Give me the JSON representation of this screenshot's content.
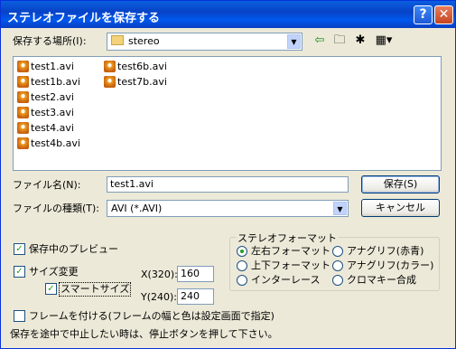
{
  "window": {
    "title": "ステレオファイルを保存する"
  },
  "location": {
    "label": "保存する場所(I):",
    "value": "stereo"
  },
  "files": [
    "test1.avi",
    "test1b.avi",
    "test2.avi",
    "test3.avi",
    "test4.avi",
    "test4b.avi",
    "test6b.avi",
    "test7b.avi"
  ],
  "filename": {
    "label": "ファイル名(N):",
    "value": "test1.avi"
  },
  "filetype": {
    "label": "ファイルの種類(T):",
    "value": "AVI (*.AVI)"
  },
  "buttons": {
    "save": "保存(S)",
    "cancel": "キャンセル"
  },
  "options": {
    "preview": "保存中のプレビュー",
    "resize": "サイズ変更",
    "smart_size": "スマートサイズ",
    "x_label": "X(320):",
    "x_value": "160",
    "y_label": "Y(240):",
    "y_value": "240",
    "frame": "フレームを付ける(フレームの幅と色は設定画面で指定)"
  },
  "stereo_format": {
    "legend": "ステレオフォーマット",
    "items": [
      "左右フォーマット",
      "アナグリフ(赤青)",
      "上下フォーマット",
      "アナグリフ(カラー)",
      "インターレース",
      "クロマキー合成"
    ]
  },
  "status_text": "保存を途中で中止したい時は、停止ボタンを押して下さい。",
  "icons": [
    "back-icon",
    "up-folder-icon",
    "new-folder-icon",
    "view-menu-icon",
    "folder-icon",
    "avi-file-icon"
  ]
}
